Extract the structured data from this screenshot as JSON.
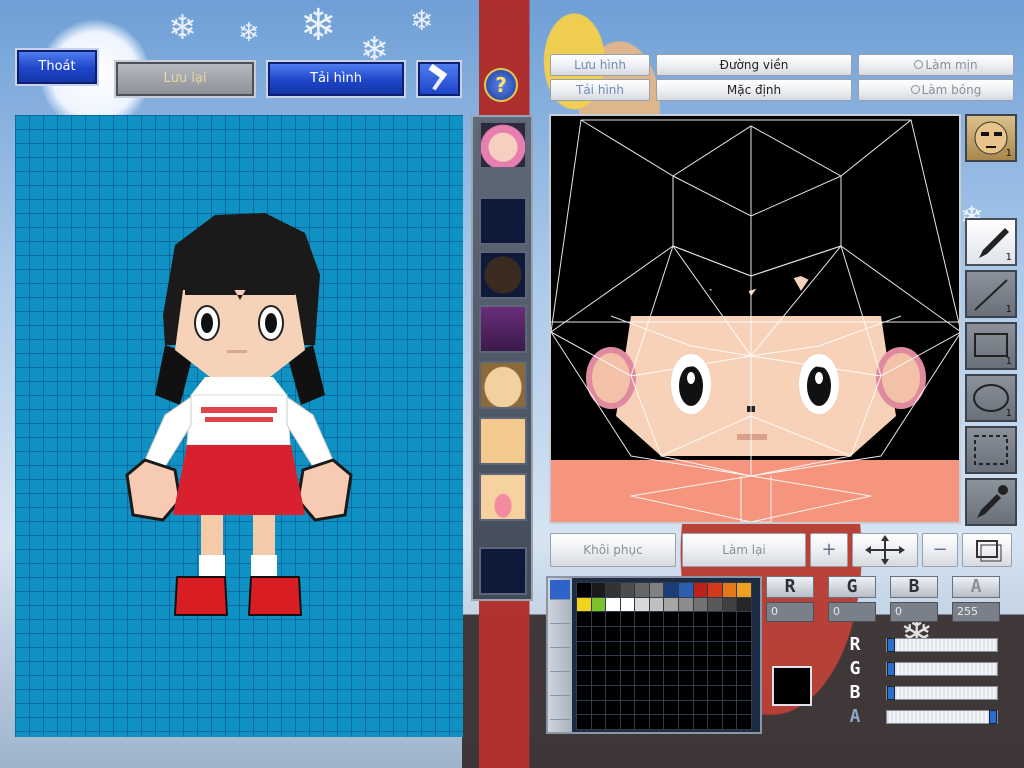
{
  "top_left": {
    "exit_label": "Thoát",
    "save_label": "Lưu lại",
    "reload_label": "Tải hình"
  },
  "editor_top": {
    "save_image": "Lưu hình",
    "load_image": "Tải hình",
    "outline": "Đường viền",
    "default": "Mặc định",
    "smooth": "Làm mịn",
    "gloss": "Làm bóng"
  },
  "editor_bottom": {
    "restore": "Khôi phục",
    "redo": "Làm lại"
  },
  "tools": {
    "avatar_count": "1",
    "pen_count": "1",
    "line_count": "1",
    "rect_count": "1",
    "ellipse_count": "1"
  },
  "channels": {
    "r_label": "R",
    "g_label": "G",
    "b_label": "B",
    "a_label": "A",
    "r_value": "0",
    "g_value": "0",
    "b_value": "0",
    "a_value": "255"
  },
  "sliders": {
    "r": 0,
    "g": 0,
    "b": 0,
    "a": 1
  },
  "colors": {
    "canvas_bg": "#0f91c4",
    "selected_color": "#000000",
    "palette_row1": [
      "#000000",
      "#1a1a1a",
      "#333333",
      "#4d4d4d",
      "#666666",
      "#808080",
      "#1b3e78",
      "#2b5fb0",
      "#c0201a",
      "#d23a1a",
      "#e2781a",
      "#f0a020"
    ],
    "palette_row2": [
      "#f2d21a",
      "#7cc22a",
      "#ffffff",
      "#ffffff",
      "#d8d8d8",
      "#bfbfbf",
      "#a6a6a6",
      "#8c8c8c",
      "#737373",
      "#595959",
      "#404040",
      "#262626"
    ]
  }
}
